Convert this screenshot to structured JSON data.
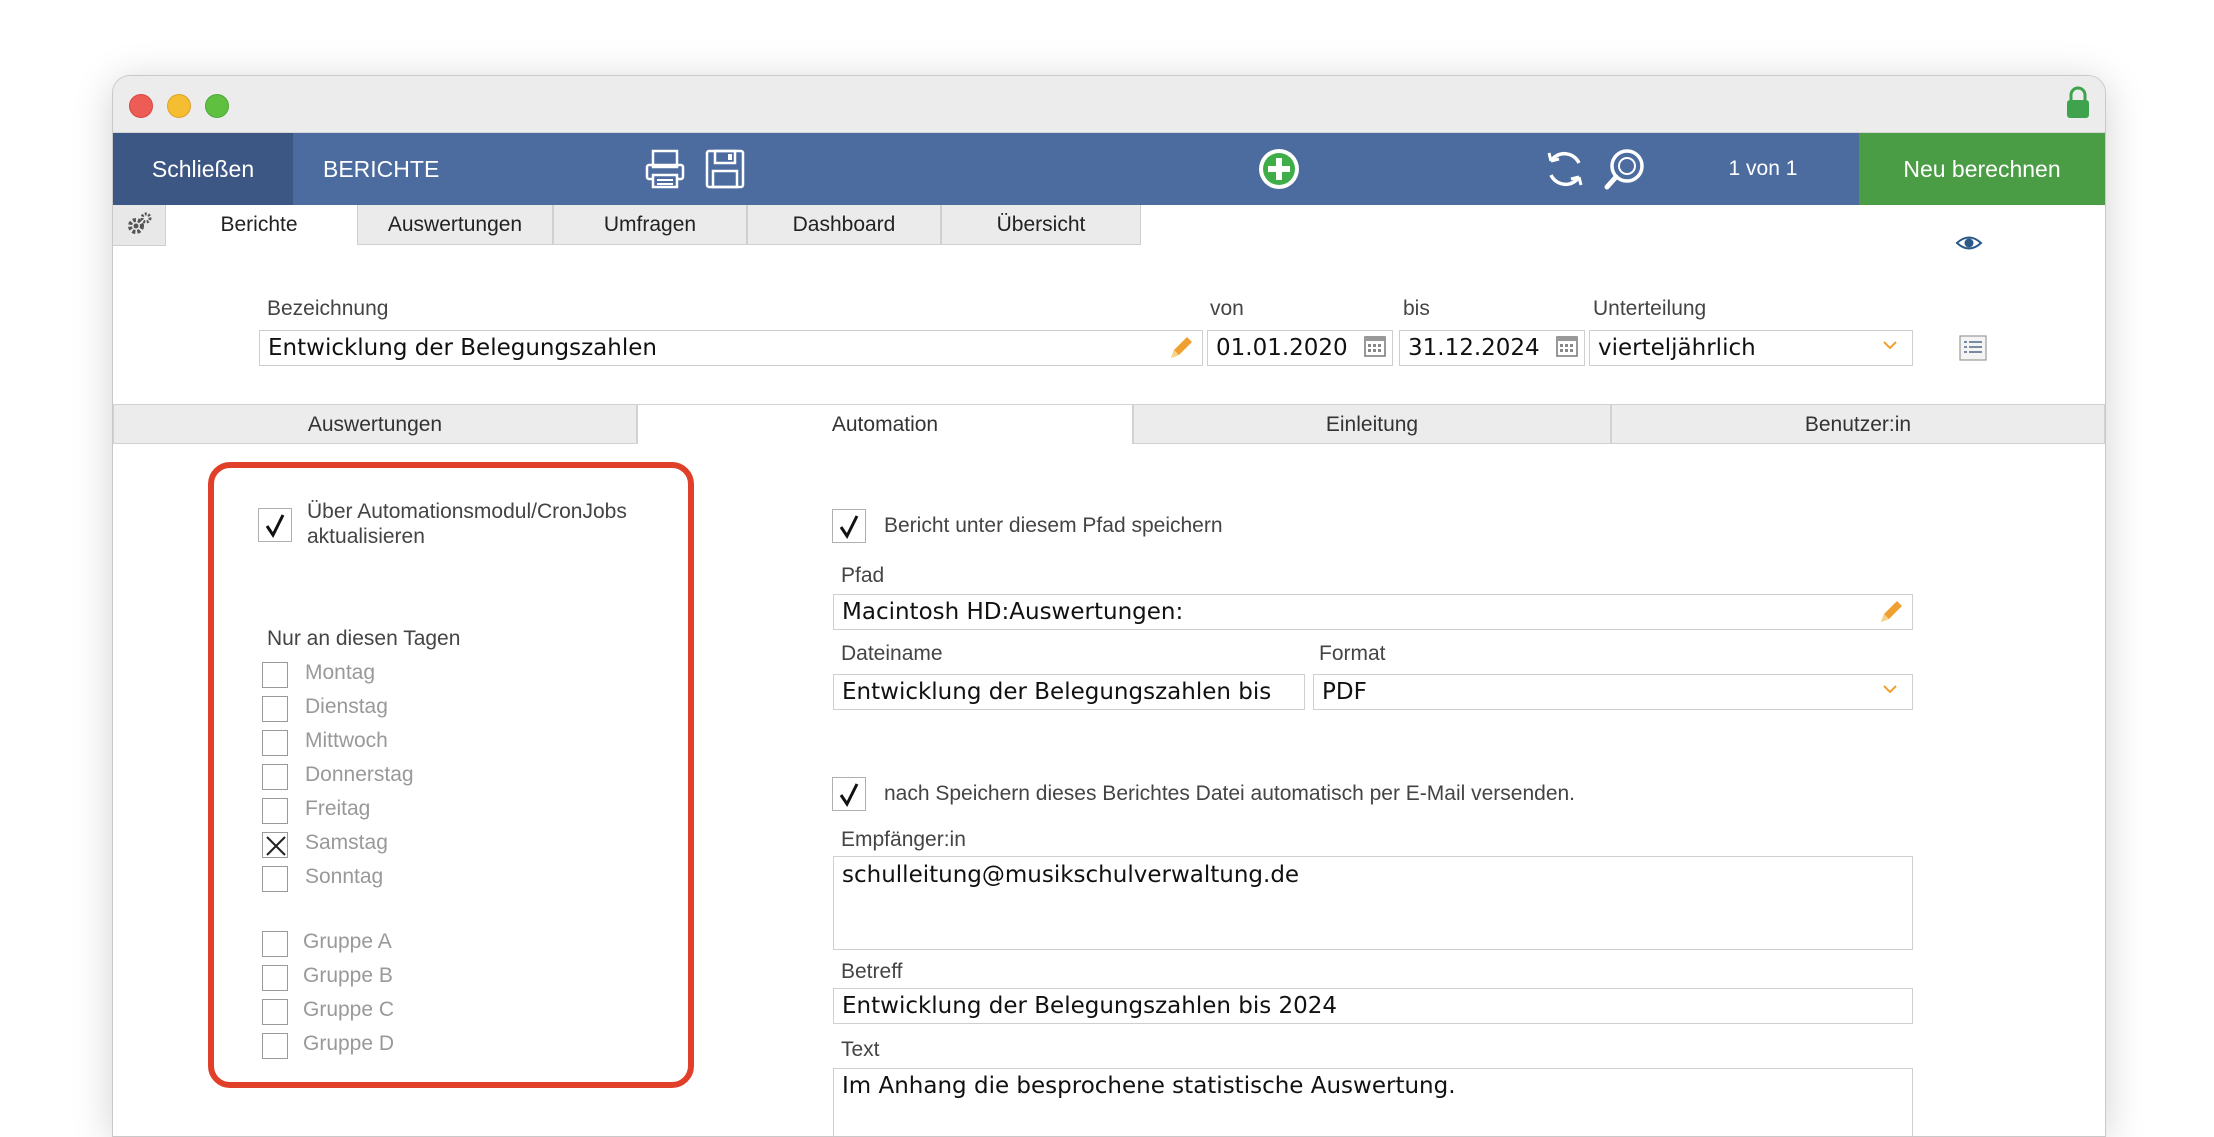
{
  "toolbar": {
    "close_label": "Schließen",
    "title": "BERICHTE",
    "pager": "1 von 1",
    "recalc_label": "Neu berechnen"
  },
  "main_tabs": [
    "Berichte",
    "Auswertungen",
    "Umfragen",
    "Dashboard",
    "Übersicht"
  ],
  "report": {
    "name_label": "Bezeichnung",
    "name_value": "Entwicklung der Belegungszahlen",
    "from_label": "von",
    "from_value": "01.01.2020",
    "to_label": "bis",
    "to_value": "31.12.2024",
    "division_label": "Unterteilung",
    "division_value": "vierteljährlich"
  },
  "sub_tabs": [
    "Auswertungen",
    "Automation",
    "Einleitung",
    "Benutzer:in"
  ],
  "automation": {
    "update_label_line1": "Über Automationsmodul/CronJobs",
    "update_label_line2": "aktualisieren",
    "update_checked": true,
    "days_heading": "Nur an diesen Tagen",
    "days": [
      "Montag",
      "Dienstag",
      "Mittwoch",
      "Donnerstag",
      "Freitag",
      "Samstag",
      "Sonntag"
    ],
    "days_checked": [
      false,
      false,
      false,
      false,
      false,
      true,
      false
    ],
    "groups": [
      "Gruppe A",
      "Gruppe B",
      "Gruppe C",
      "Gruppe D"
    ]
  },
  "save": {
    "save_label": "Bericht unter diesem Pfad speichern",
    "path_label": "Pfad",
    "path_value": "Macintosh HD:Auswertungen:",
    "filename_label": "Dateiname",
    "filename_value": "Entwicklung der Belegungszahlen bis",
    "format_label": "Format",
    "format_value": "PDF"
  },
  "email": {
    "send_label": "nach Speichern dieses Berichtes Datei automatisch per E-Mail versenden.",
    "recipient_label": "Empfänger:in",
    "recipient_value": "schulleitung@musikschulverwaltung.de",
    "subject_label": "Betreff",
    "subject_value": "Entwicklung der Belegungszahlen bis 2024",
    "text_label": "Text",
    "text_value": "Im Anhang die besprochene statistische Auswertung."
  },
  "colors": {
    "toolbar_blue": "#4c6c9f",
    "close_blue": "#3d5785",
    "recalc_green": "#4a9c45",
    "highlight_red": "#e0402a",
    "pencil_orange": "#f0a030"
  }
}
